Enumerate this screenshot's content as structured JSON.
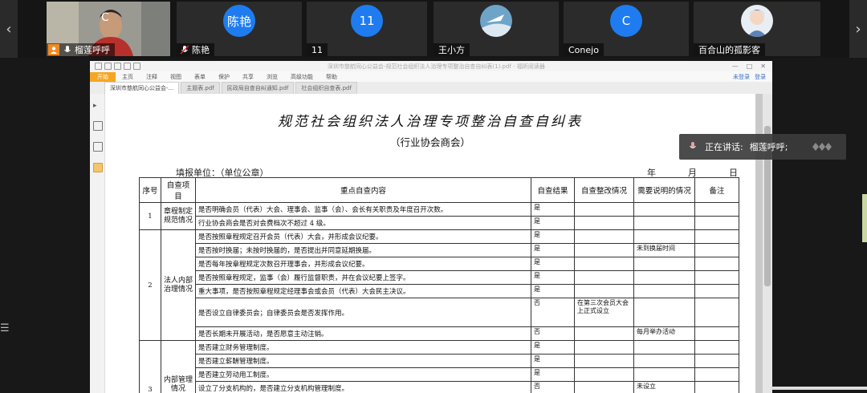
{
  "participants": [
    {
      "name": "榴莲呼呼",
      "type": "video",
      "host": true,
      "overlay_letter": "C"
    },
    {
      "name": "陈艳",
      "type": "avatar",
      "avatar_text": "陈艳"
    },
    {
      "name": "11",
      "type": "avatar",
      "avatar_text": "11"
    },
    {
      "name": "王小方",
      "type": "image"
    },
    {
      "name": "Conejo",
      "type": "avatar",
      "avatar_text": "C"
    },
    {
      "name": "百合山的孤影客",
      "type": "image"
    }
  ],
  "nav": {
    "prev": "‹",
    "next": "›"
  },
  "colors": {
    "avatar_blue": "#1e7cf0",
    "host_orange": "#f08a24",
    "menu_active": "#f5a623"
  },
  "pdf": {
    "window_title": "深圳市慈航同心公益会-规范社会组织法人治理专项整治自查自纠表(1).pdf - 福昕阅读器",
    "menu": [
      "开始",
      "主页",
      "注释",
      "视图",
      "表单",
      "保护",
      "共享",
      "浏览",
      "高级功能",
      "帮助"
    ],
    "menu_right": [
      "未登录",
      "登录"
    ],
    "tabs": [
      "深圳市慈航同心公益会-...",
      "主题表.pdf",
      "民政局自查自纠通知.pdf",
      "社会组织自查表.pdf"
    ],
    "doc": {
      "title": "规范社会组织法人治理专项整治自查自纠表",
      "subtitle": "（行业协会商会）",
      "fill_unit": "填报单位：（单位公章）",
      "date": {
        "year": "年",
        "month": "月",
        "day": "日"
      },
      "headers": [
        "序号",
        "自查项目",
        "重点自查内容",
        "自查结果",
        "自查整改情况",
        "需要说明的情况",
        "备注"
      ],
      "groups": [
        {
          "no": "1",
          "category": "章程制定规范情况",
          "rows": [
            {
              "content": "是否明确会员（代表）大会、理事会、监事（会）、会长有关职责及年度召开次数。",
              "result": "是",
              "fix": "",
              "note": "",
              "remark": ""
            },
            {
              "content": "行业协会商会是否对会费档次不超过 4 级。",
              "result": "是",
              "fix": "",
              "note": "",
              "remark": ""
            }
          ]
        },
        {
          "no": "2",
          "category": "法人内部治理情况",
          "rows": [
            {
              "content": "是否按照章程规定召开会员（代表）大会，并形成会议纪要。",
              "result": "是",
              "fix": "",
              "note": "",
              "remark": ""
            },
            {
              "content": "是否按时换届；未按时换届的，是否提出并同意延期换届。",
              "result": "是",
              "fix": "",
              "note": "未到换届时间",
              "remark": ""
            },
            {
              "content": "是否每年按章程规定次数召开理事会，并形成会议纪要。",
              "result": "是",
              "fix": "",
              "note": "",
              "remark": ""
            },
            {
              "content": "是否按照章程规定，监事（会）履行监督职责，并在会议纪要上签字。",
              "result": "是",
              "fix": "",
              "note": "",
              "remark": ""
            },
            {
              "content": "重大事项，是否按照章程规定经理事会或会员（代表）大会民主决议。",
              "result": "是",
              "fix": "",
              "note": "",
              "remark": ""
            },
            {
              "content": "是否设立自律委员会；自律委员会是否发挥作用。",
              "result": "否",
              "fix": "在第三次会员大会上正式设立",
              "note": "",
              "remark": ""
            },
            {
              "content": "是否长期未开展活动，是否愿意主动注销。",
              "result": "否",
              "fix": "",
              "note": "每月举办活动",
              "remark": ""
            }
          ]
        },
        {
          "no": "3",
          "category": "内部管理情况",
          "rows": [
            {
              "content": "是否建立财务管理制度。",
              "result": "是",
              "fix": "",
              "note": "",
              "remark": ""
            },
            {
              "content": "是否建立薪酬管理制度。",
              "result": "是",
              "fix": "",
              "note": "",
              "remark": ""
            },
            {
              "content": "是否建立劳动用工制度。",
              "result": "是",
              "fix": "",
              "note": "",
              "remark": ""
            },
            {
              "content": "设立了分支机构的，是否建立分支机构管理制度。",
              "result": "否",
              "fix": "",
              "note": "未设立",
              "remark": ""
            }
          ]
        }
      ]
    }
  },
  "speaking": {
    "label": "正在讲话:",
    "name": "榴莲呼呼;"
  }
}
